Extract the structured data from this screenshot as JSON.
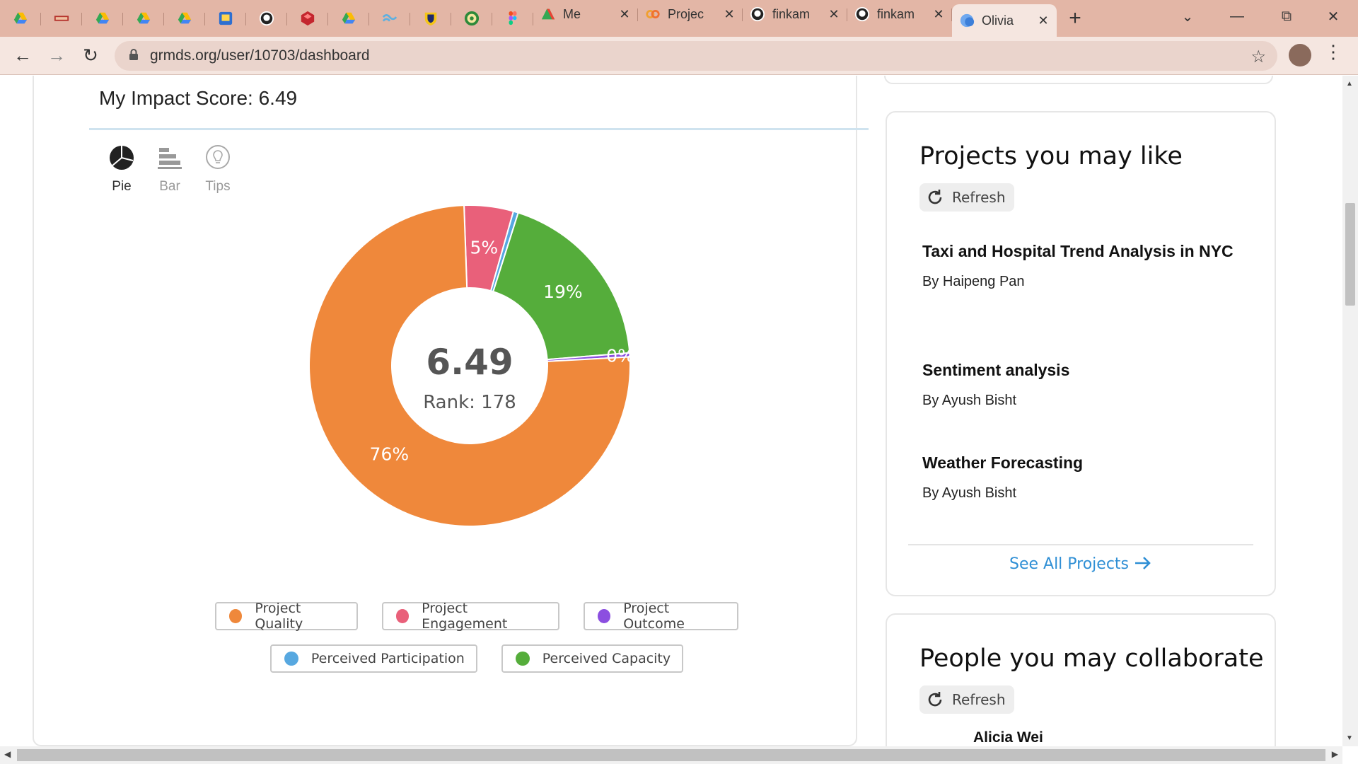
{
  "browser": {
    "favicon_tabs": [
      {
        "icon": "google-drive-icon"
      },
      {
        "icon": "red-bar-icon"
      },
      {
        "icon": "google-drive-icon"
      },
      {
        "icon": "google-drive-icon"
      },
      {
        "icon": "google-drive-icon"
      },
      {
        "icon": "blue-box-icon"
      },
      {
        "icon": "github-icon"
      },
      {
        "icon": "red-cube-icon"
      },
      {
        "icon": "google-drive-icon"
      },
      {
        "icon": "blue-wave-icon"
      },
      {
        "icon": "shield-icon"
      },
      {
        "icon": "green-seal-icon"
      },
      {
        "icon": "figma-icon"
      }
    ],
    "text_tabs": [
      {
        "label": "Me",
        "icon": "drive-record-icon"
      },
      {
        "label": "Projec",
        "icon": "link-icon"
      },
      {
        "label": "finkam",
        "icon": "github-icon"
      },
      {
        "label": "finkam",
        "icon": "github-icon"
      },
      {
        "label": "Olivia",
        "icon": "globe-icon",
        "active": true
      }
    ],
    "url": "grmds.org/user/10703/dashboard"
  },
  "impact": {
    "title": "My Impact Score: 6.49",
    "chart_tabs": [
      {
        "label": "Pie",
        "icon": "pie-chart-icon",
        "active": true
      },
      {
        "label": "Bar",
        "icon": "bar-chart-icon"
      },
      {
        "label": "Tips",
        "icon": "lightbulb-icon"
      }
    ],
    "center_value": "6.49",
    "rank": "Rank: 178"
  },
  "chart_data": {
    "type": "pie",
    "donut": true,
    "series": [
      {
        "name": "Project Quality",
        "value": 76,
        "label": "76%",
        "color": "#ef883b"
      },
      {
        "name": "Project Engagement",
        "value": 5,
        "label": "5%",
        "color": "#e9607a"
      },
      {
        "name": "Perceived Participation",
        "value": 0.5,
        "label": "",
        "color": "#57a8e0"
      },
      {
        "name": "Perceived Capacity",
        "value": 19,
        "label": "19%",
        "color": "#55ad3b"
      },
      {
        "name": "Project Outcome",
        "value": 0.4,
        "label": "0%",
        "color": "#8c4fe0"
      }
    ],
    "legend": [
      [
        "Project Quality",
        "Project Engagement",
        "Project Outcome"
      ],
      [
        "Perceived Participation",
        "Perceived Capacity"
      ]
    ]
  },
  "projects_card": {
    "title": "Projects you may like",
    "refresh": "Refresh",
    "items": [
      {
        "title": "Taxi and Hospital Trend Analysis in NYC",
        "author": "By Haipeng Pan"
      },
      {
        "title": "Sentiment analysis",
        "author": "By Ayush Bisht"
      },
      {
        "title": "Weather Forecasting",
        "author": "By Ayush Bisht"
      }
    ],
    "see_all": "See All Projects"
  },
  "people_card": {
    "title": "People you may collaborate",
    "refresh": "Refresh",
    "first_person": "Alicia Wei"
  }
}
